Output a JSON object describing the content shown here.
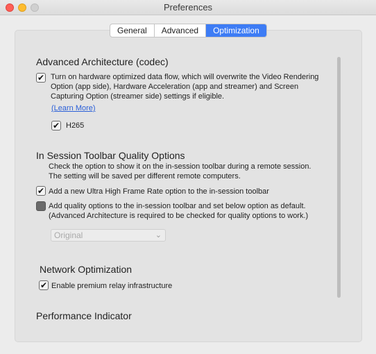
{
  "window": {
    "title": "Preferences"
  },
  "tabs": [
    {
      "label": "General"
    },
    {
      "label": "Advanced"
    },
    {
      "label": "Optimization"
    }
  ],
  "advanced_architecture": {
    "title": "Advanced Architecture (codec)",
    "hw_checkbox_checked": true,
    "hw_line1": "Turn on hardware optimized data flow, which will overwrite the Video Rendering",
    "hw_line2": "Option (app side), Hardware Acceleration (app and streamer) and Screen",
    "hw_line3": "Capturing Option (streamer side) settings if eligible.",
    "learn_more": "(Learn More)",
    "h265_checked": true,
    "h265_label": "H265"
  },
  "toolbar_quality": {
    "title": "In Session Toolbar Quality Options",
    "desc_line1": "Check the option to show it on the in-session toolbar during a remote session.",
    "desc_line2": "The setting will be saved per different remote computers.",
    "uhfr_checked": true,
    "uhfr_label": "Add a new Ultra High Frame Rate option to the in-session toolbar",
    "quality_checked": false,
    "quality_line1": "Add quality options to the in-session toolbar and set below option as default.",
    "quality_line2": "(Advanced Architecture is required to be checked for quality options to work.)",
    "select_value": "Original"
  },
  "network": {
    "title": "Network Optimization",
    "relay_checked": true,
    "relay_label": "Enable premium relay infrastructure"
  },
  "performance": {
    "title": "Performance Indicator"
  }
}
